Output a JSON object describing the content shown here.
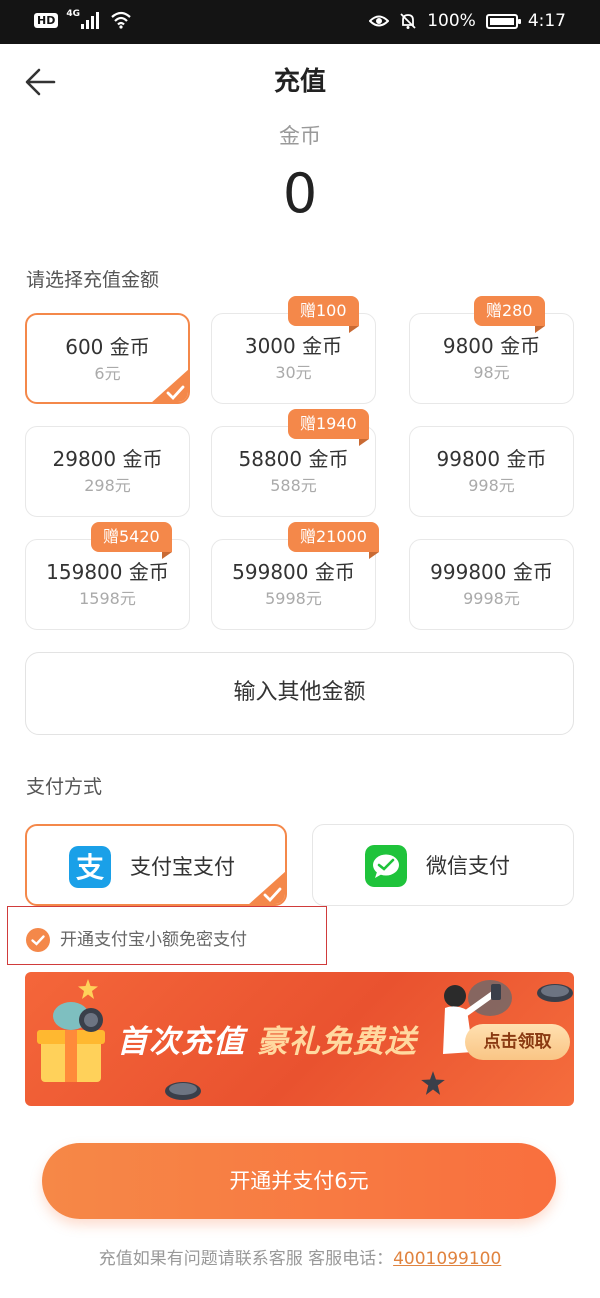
{
  "status_bar": {
    "hd": "HD",
    "network": "4G",
    "battery_percent": "100%",
    "time": "4:17"
  },
  "header": {
    "title": "充值"
  },
  "balance": {
    "label": "金币",
    "value": "0"
  },
  "amount_section": {
    "label": "请选择充值金额",
    "options": [
      {
        "coins": "600 金币",
        "price": "6元",
        "bonus": "",
        "selected": true
      },
      {
        "coins": "3000 金币",
        "price": "30元",
        "bonus": "赠100",
        "selected": false
      },
      {
        "coins": "9800 金币",
        "price": "98元",
        "bonus": "赠280",
        "selected": false
      },
      {
        "coins": "29800 金币",
        "price": "298元",
        "bonus": "",
        "selected": false
      },
      {
        "coins": "58800 金币",
        "price": "588元",
        "bonus": "赠1940",
        "selected": false
      },
      {
        "coins": "99800 金币",
        "price": "998元",
        "bonus": "",
        "selected": false
      },
      {
        "coins": "159800 金币",
        "price": "1598元",
        "bonus": "赠5420",
        "selected": false
      },
      {
        "coins": "599800 金币",
        "price": "5998元",
        "bonus": "赠21000",
        "selected": false
      },
      {
        "coins": "999800 金币",
        "price": "9998元",
        "bonus": "",
        "selected": false
      }
    ],
    "custom_label": "输入其他金额"
  },
  "payment_section": {
    "label": "支付方式",
    "methods": [
      {
        "label": "支付宝支付",
        "icon": "alipay-icon",
        "color": "#1aa0e8",
        "selected": true
      },
      {
        "label": "微信支付",
        "icon": "wechat-icon",
        "color": "#1fc33b",
        "selected": false
      }
    ],
    "agreement": "开通支付宝小额免密支付",
    "agreement_checked": true
  },
  "banner": {
    "title_part1": "首次充值",
    "title_part2": "豪礼免费送",
    "button": "点击领取"
  },
  "pay_button": "开通并支付6元",
  "footer": {
    "text": "充值如果有问题请联系客服 客服电话：",
    "phone": "4001099100"
  },
  "colors": {
    "accent": "#f4884a",
    "highlight_border": "#d03b3b"
  }
}
